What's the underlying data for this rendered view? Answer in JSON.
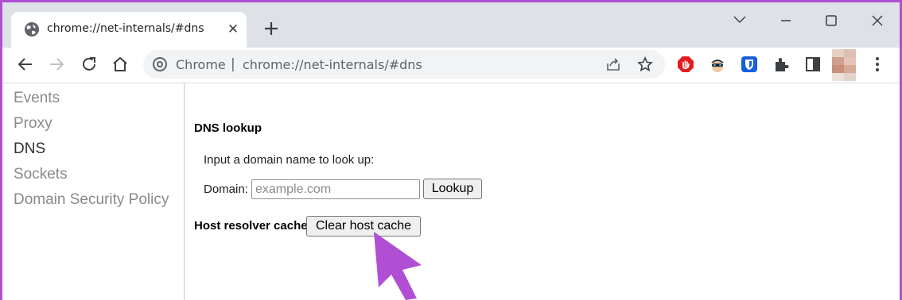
{
  "tab": {
    "title": "chrome://net-internals/#dns",
    "close": "✕"
  },
  "newtab": "+",
  "omnibox": {
    "origin": "Chrome",
    "separator": "|",
    "url": "chrome://net-internals/#dns"
  },
  "sidebar": {
    "items": [
      {
        "label": "Events"
      },
      {
        "label": "Proxy"
      },
      {
        "label": "DNS",
        "active": true
      },
      {
        "label": "Sockets"
      },
      {
        "label": "Domain Security Policy"
      }
    ]
  },
  "dns": {
    "lookup_title": "DNS lookup",
    "hint": "Input a domain name to look up:",
    "domain_label": "Domain:",
    "domain_placeholder": "example.com",
    "domain_value": "",
    "lookup_button": "Lookup",
    "cache_title": "Host resolver cache",
    "clear_button": "Clear host cache"
  },
  "colors": {
    "accent_arrow": "#b04fd4",
    "frame": "#b04fd4"
  },
  "icons": [
    "globe-icon",
    "close-icon",
    "plus-icon",
    "minimize-icon",
    "maximize-icon",
    "window-close-icon",
    "back-icon",
    "forward-icon",
    "reload-icon",
    "home-icon",
    "chrome-icon",
    "share-icon",
    "star-icon",
    "adblock-icon",
    "spy-extension-icon",
    "bitwarden-icon",
    "extensions-icon",
    "side-panel-icon",
    "avatar",
    "menu-icon"
  ]
}
